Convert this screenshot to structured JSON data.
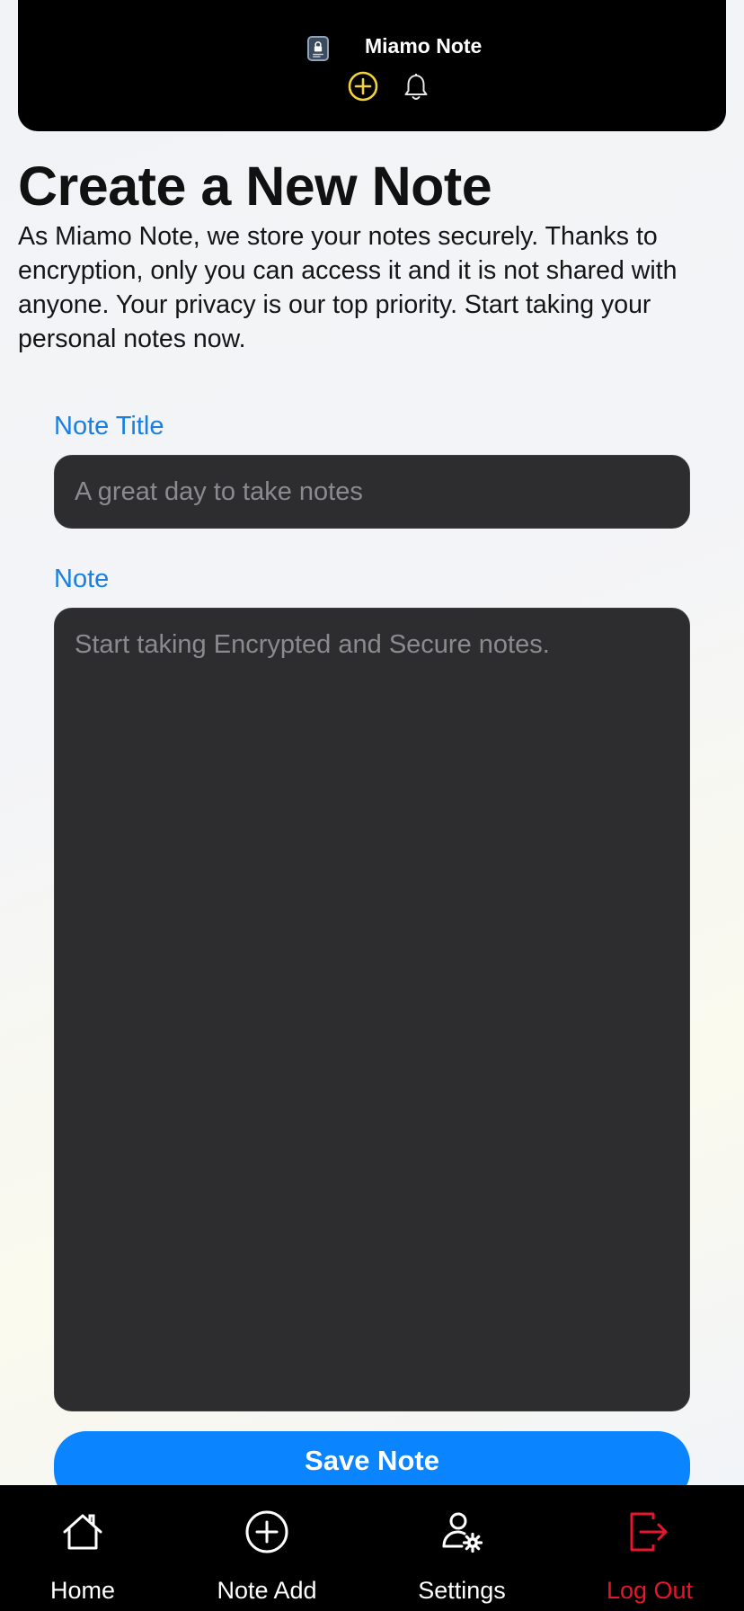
{
  "app": {
    "name": "Miamo Note",
    "accent": "#0a84ff",
    "danger": "#e5162e"
  },
  "header": {
    "logo_icon": "app-logo-icon",
    "brand": "Miamo Note",
    "icons": [
      "add-circle-icon",
      "bell-icon"
    ]
  },
  "page": {
    "title": "Create a New Note",
    "intro": "As Miamo Note, we store your notes securely. Thanks to encryption, only you can access it and it is not shared with anyone. Your privacy is our top priority. Start taking your personal notes now."
  },
  "form": {
    "title_label": "Note Title",
    "title_value": "",
    "title_placeholder": "A great day to take notes",
    "note_label": "Note",
    "note_value": "",
    "note_placeholder": "Start taking Encrypted and Secure notes.",
    "save_label": "Save Note"
  },
  "nav": {
    "items": [
      {
        "label": "Home",
        "icon": "home-icon"
      },
      {
        "label": "Note Add",
        "icon": "add-circle-icon"
      },
      {
        "label": "Settings",
        "icon": "user-settings-icon"
      },
      {
        "label": "Log Out",
        "icon": "logout-icon"
      }
    ]
  }
}
